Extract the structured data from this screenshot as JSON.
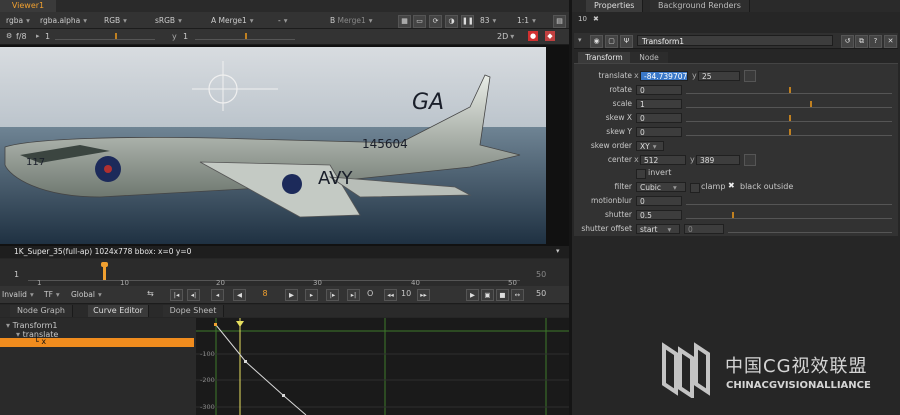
{
  "viewer": {
    "tab": "Viewer1",
    "channels": "rgba",
    "alpha": "rgba.alpha",
    "rgb": "RGB",
    "colorspace": "sRGB",
    "a_label": "A",
    "a_input": "Merge1",
    "dash": "-",
    "b_label": "B",
    "b_input": "Merge1",
    "gain": "83",
    "zoom": "1:1",
    "fstop": "f/8",
    "gamma_value": "1",
    "y_label": "y",
    "y_value": "1",
    "mode": "2D",
    "format_info": "1K_Super_35(full-ap) 1024x778  bbox: x=0 y=0"
  },
  "image": {
    "tail_letters": "GA",
    "tail_number": "145604",
    "nose_number": "117",
    "wing_text": "AVY"
  },
  "timeline": {
    "start": "1",
    "end": "50",
    "ticks": [
      "1",
      "10",
      "20",
      "30",
      "40",
      "50"
    ],
    "current_frame": "8",
    "step": "10",
    "end_frame": "50",
    "invalid": "Invalid",
    "tf": "TF",
    "global": "Global",
    "o_label": "O"
  },
  "panels": {
    "tabs": [
      "Node Graph",
      "Curve Editor",
      "Dope Sheet"
    ],
    "tree_root": "Transform1",
    "tree_child": "translate",
    "tree_leaf": "x",
    "y_axis": [
      "-100",
      "-200",
      "-300"
    ]
  },
  "properties": {
    "tabs": [
      "Properties",
      "Background Renders"
    ],
    "max_panels": "10",
    "node_name": "Transform1",
    "subtabs": [
      "Transform",
      "Node"
    ],
    "translate": {
      "label": "translate",
      "x_label": "x",
      "x": "-84.739707",
      "y_label": "y",
      "y": "25"
    },
    "rotate": {
      "label": "rotate",
      "value": "0"
    },
    "scale": {
      "label": "scale",
      "value": "1"
    },
    "skew_x": {
      "label": "skew X",
      "value": "0"
    },
    "skew_y": {
      "label": "skew Y",
      "value": "0"
    },
    "skew_order": {
      "label": "skew order",
      "value": "XY"
    },
    "center": {
      "label": "center",
      "x_label": "x",
      "x": "512",
      "y_label": "y",
      "y": "389"
    },
    "invert": "invert",
    "filter": {
      "label": "filter",
      "value": "Cubic"
    },
    "clamp": "clamp",
    "black_outside": "black outside",
    "motionblur": {
      "label": "motionblur",
      "value": "0"
    },
    "shutter": {
      "label": "shutter",
      "value": "0.5"
    },
    "shutter_offset": {
      "label": "shutter offset",
      "value": "start",
      "extra": "0"
    }
  },
  "watermark": {
    "cn": "中国CG视效联盟",
    "en": "CHINACGVISIONALLIANCE"
  },
  "colors": {
    "accent": "#f0a030",
    "highlight": "#3a78c8",
    "curve_grid": "#3d7a2a"
  }
}
